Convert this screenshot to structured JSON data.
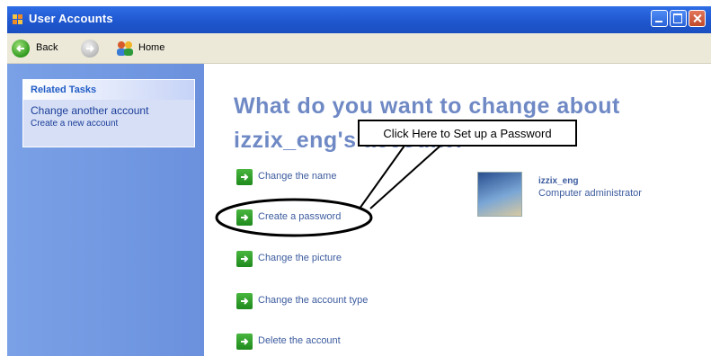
{
  "window": {
    "title": "User Accounts"
  },
  "toolbar": {
    "back_label": "Back",
    "home_label": "Home"
  },
  "sidebar": {
    "panel_title": "Related Tasks",
    "links": [
      "Change another account",
      "Create a new account"
    ]
  },
  "main": {
    "heading": "What do you want to change about izzix_eng's account?",
    "options": [
      "Change the name",
      "Create a password",
      "Change the picture",
      "Change the account type",
      "Delete the account"
    ],
    "account": {
      "name": "izzix_eng",
      "role": "Computer administrator"
    }
  },
  "annotation": {
    "text": "Click Here to Set up a Password"
  }
}
